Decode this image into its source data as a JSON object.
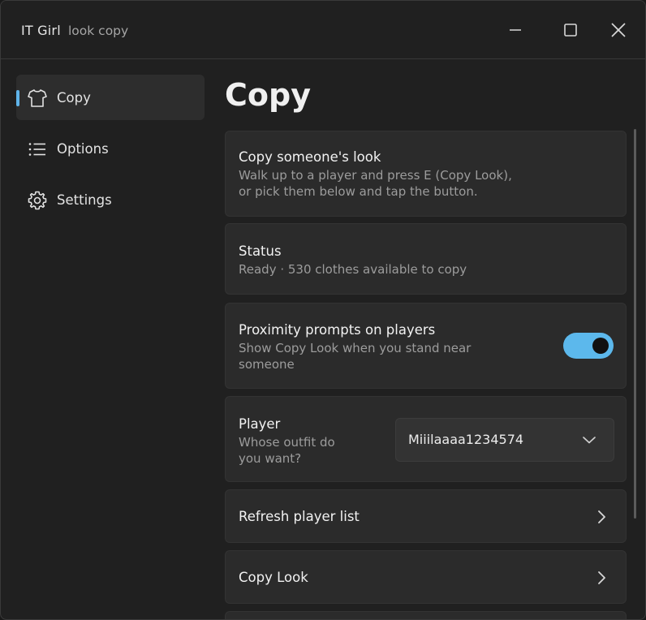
{
  "window": {
    "title": "IT Girl",
    "subtitle": "look copy"
  },
  "sidebar": {
    "items": [
      {
        "label": "Copy",
        "icon": "shirt-icon",
        "active": true
      },
      {
        "label": "Options",
        "icon": "list-icon",
        "active": false
      },
      {
        "label": "Settings",
        "icon": "gear-icon",
        "active": false
      }
    ]
  },
  "main": {
    "title": "Copy",
    "cards": {
      "copy_look": {
        "title": "Copy someone's look",
        "line1": "Walk up to a player and press E (Copy Look),",
        "line2": "or pick them below and tap the button."
      },
      "status": {
        "title": "Status",
        "text": "Ready · 530 clothes available to copy"
      },
      "proximity": {
        "title": "Proximity prompts on players",
        "line1": "Show Copy Look when you stand near",
        "line2": "someone",
        "enabled": true
      },
      "player": {
        "title": "Player",
        "line1": "Whose outfit do",
        "line2": "you want?",
        "selected": "Miiilaaaa1234574"
      },
      "refresh": {
        "label": "Refresh player list"
      },
      "copy_button": {
        "label": "Copy Look"
      }
    }
  },
  "colors": {
    "accent": "#5cb8ec",
    "background": "#202020",
    "card": "#2b2b2b"
  }
}
